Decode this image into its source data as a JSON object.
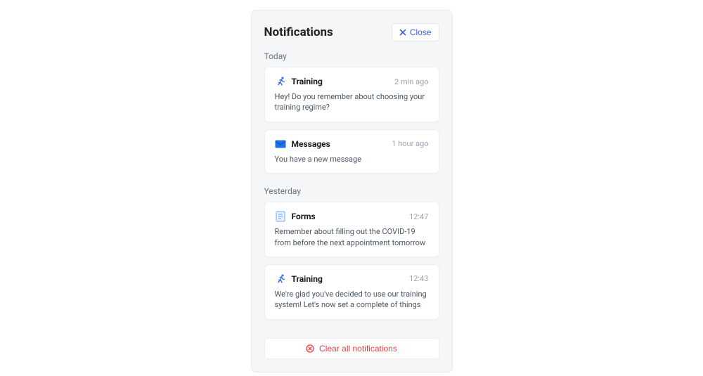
{
  "header": {
    "title": "Notifications",
    "close_label": "Close"
  },
  "sections": [
    {
      "label": "Today",
      "items": [
        {
          "icon": "training",
          "title": "Training",
          "time": "2 min ago",
          "body": "Hey! Do you remember about choosing your training regime?"
        },
        {
          "icon": "messages",
          "title": "Messages",
          "time": "1 hour ago",
          "body": "You have a new message"
        }
      ]
    },
    {
      "label": "Yesterday",
      "items": [
        {
          "icon": "forms",
          "title": "Forms",
          "time": "12:47",
          "body": "Remember about filling out the COVID-19 from before the next appointment tomorrow"
        },
        {
          "icon": "training",
          "title": "Training",
          "time": "12:43",
          "body": "We're glad you've decided to use our training system! Let's now set a complete of things"
        }
      ]
    }
  ],
  "clear_label": "Clear all notifications"
}
